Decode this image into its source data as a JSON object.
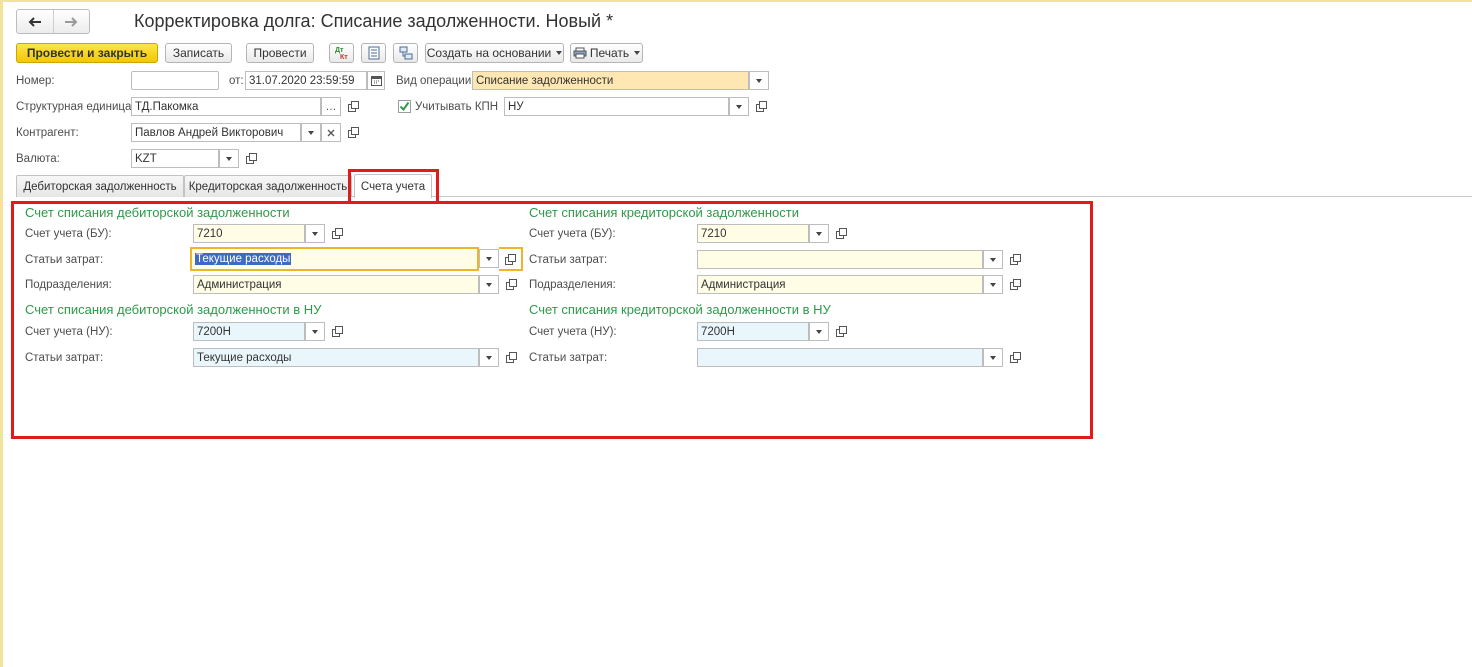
{
  "window": {
    "title": "Корректировка долга: Списание задолженности. Новый *"
  },
  "toolbar": {
    "post_close": "Провести и закрыть",
    "save": "Записать",
    "post": "Провести",
    "dtkt_icon": "dt-kt-icon",
    "dtkt_text_top": "Дт",
    "dtkt_text_bottom": "Кт",
    "create_based": "Создать на основании",
    "print": "Печать"
  },
  "header": {
    "number_label": "Номер:",
    "number_value": "",
    "date_label": "от:",
    "date_value": "31.07.2020 23:59:59",
    "operation_label": "Вид операции:",
    "operation_value": "Списание задолженности",
    "unit_label": "Структурная единица:",
    "unit_value": "ТД.Пакомка",
    "kpn_label": "Учитывать КПН",
    "kpn_checked": true,
    "kpn_value": "НУ",
    "counterparty_label": "Контрагент:",
    "counterparty_value": "Павлов Андрей Викторович",
    "currency_label": "Валюта:",
    "currency_value": "KZT"
  },
  "tabs": [
    {
      "label": "Дебиторская задолженность",
      "active": false
    },
    {
      "label": "Кредиторская задолженность",
      "active": false
    },
    {
      "label": "Счета учета",
      "active": true
    }
  ],
  "accounts": {
    "left": {
      "title": "Счет списания дебиторской задолженности",
      "account_label": "Счет учета (БУ):",
      "account_value": "7210",
      "expense_label": "Статьи затрат:",
      "expense_value": "Текущие расходы",
      "division_label": "Подразделения:",
      "division_value": "Администрация",
      "tax_title": "Счет списания дебиторской задолженности в НУ",
      "tax_account_label": "Счет учета (НУ):",
      "tax_account_value": "7200Н",
      "tax_expense_label": "Статьи затрат:",
      "tax_expense_value": "Текущие расходы"
    },
    "right": {
      "title": "Счет списания кредиторской задолженности",
      "account_label": "Счет учета (БУ):",
      "account_value": "7210",
      "expense_label": "Статьи затрат:",
      "expense_value": "",
      "division_label": "Подразделения:",
      "division_value": "Администрация",
      "tax_title": "Счет списания кредиторской задолженности в НУ",
      "tax_account_label": "Счет учета (НУ):",
      "tax_account_value": "7200Н",
      "tax_expense_label": "Статьи затрат:",
      "tax_expense_value": ""
    }
  },
  "colors": {
    "accent_yellow": "#f3c800",
    "section_green": "#2e9a4a",
    "highlight_red": "#e21a1a",
    "field_yellow": "#fffde5",
    "field_blue": "#e9f6fc",
    "field_orange": "#ffe7b3"
  },
  "icons": {
    "back": "arrow-left-icon",
    "forward": "arrow-right-icon",
    "calendar": "calendar-icon",
    "open": "open-form-icon",
    "clear": "clear-icon",
    "list": "document-list-icon",
    "structure": "structure-icon",
    "printer": "printer-icon"
  }
}
